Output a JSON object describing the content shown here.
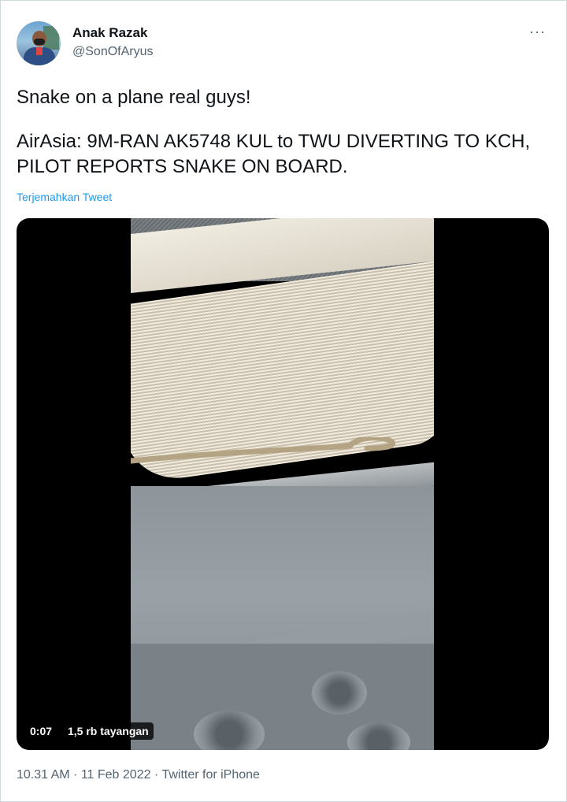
{
  "user": {
    "name": "Anak Razak",
    "handle": "@SonOfAryus"
  },
  "more_label": "···",
  "tweet": {
    "line1": "Snake on a plane real guys!",
    "line2": "AirAsia: 9M-RAN AK5748 KUL to TWU DIVERTING TO KCH, PILOT REPORTS SNAKE ON BOARD.",
    "translate_label": "Terjemahkan Tweet"
  },
  "media": {
    "duration": "0:07",
    "views": "1,5 rb tayangan"
  },
  "meta": {
    "time": "10.31 AM",
    "date": "11 Feb 2022",
    "separator": " · ",
    "source": "Twitter for iPhone"
  },
  "colors": {
    "link": "#1d9bf0",
    "secondary_text": "#536471"
  }
}
